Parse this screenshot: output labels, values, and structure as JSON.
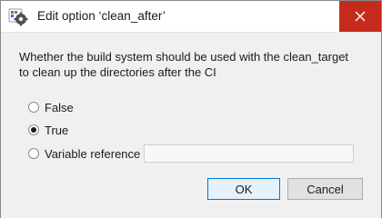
{
  "window": {
    "title": "Edit option ‘clean_after’",
    "close_icon": "close-icon",
    "accent_close": "#c42b1c"
  },
  "dialog": {
    "description": "Whether the build system should be used with the clean_target to clean up the directories after the CI",
    "options": [
      {
        "label": "False",
        "checked": false
      },
      {
        "label": "True",
        "checked": true
      },
      {
        "label": "Variable reference",
        "checked": false
      }
    ],
    "variable_value": ""
  },
  "buttons": {
    "ok_label": "OK",
    "cancel_label": "Cancel"
  }
}
